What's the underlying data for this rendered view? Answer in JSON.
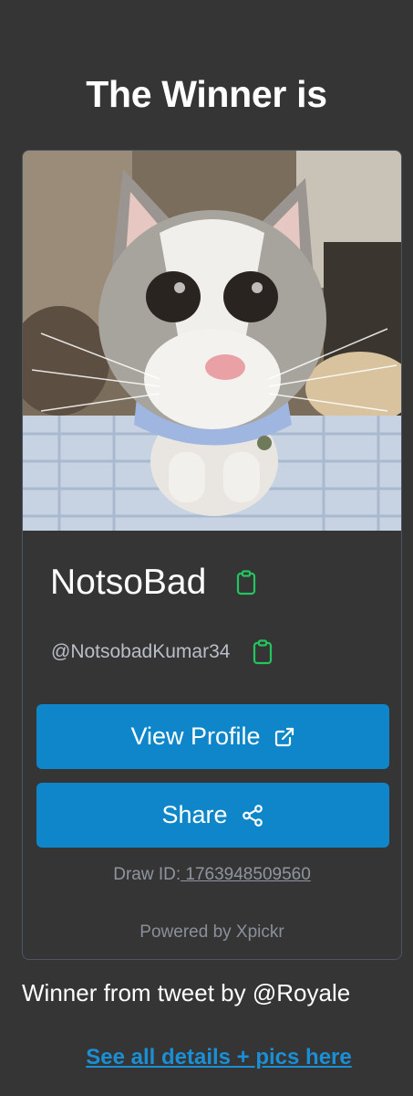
{
  "headline": "The Winner is",
  "winner": {
    "display_name": "NotsoBad",
    "handle": "@NotsobadKumar34"
  },
  "buttons": {
    "view_profile": "View Profile",
    "share": "Share"
  },
  "draw": {
    "label": "Draw ID:",
    "id": " 1763948509560"
  },
  "powered_by": "Powered by Xpickr",
  "tweet_line": "Winner from tweet by @Royale",
  "details_link": "See all details + pics here",
  "colors": {
    "background": "#353535",
    "button": "#0e86c9",
    "clipboard_icon": "#22c55e",
    "link": "#1a8fd6"
  },
  "icons": {
    "copy_name": "clipboard-icon",
    "copy_handle": "clipboard-icon",
    "view_profile": "external-link-icon",
    "share": "share-icon"
  }
}
